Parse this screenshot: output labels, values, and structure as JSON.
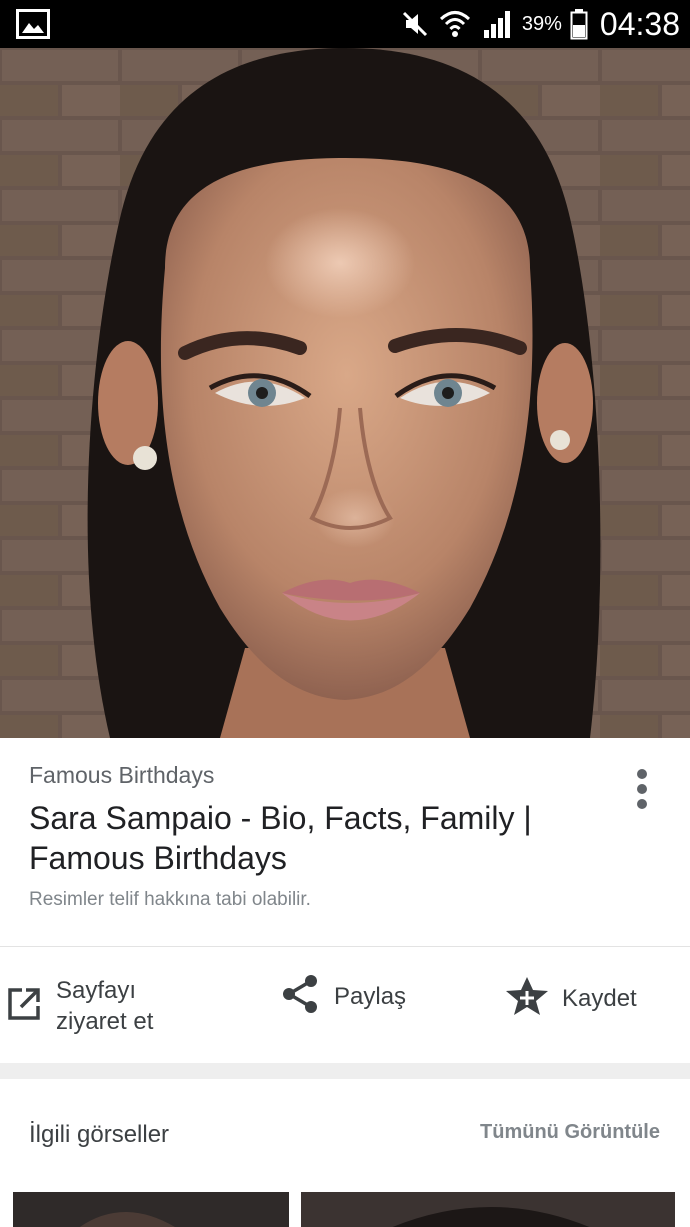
{
  "status_bar": {
    "battery_percent": "39%",
    "time": "04:38",
    "icons": [
      "gallery-icon",
      "mute-icon",
      "wifi-icon",
      "signal-icon",
      "battery-icon"
    ]
  },
  "image": {
    "subject": "portrait-photo"
  },
  "result": {
    "source": "Famous Birthdays",
    "title": "Sara Sampaio - Bio, Facts, Family | Famous Birthdays",
    "copyright_notice": "Resimler telif hakkına tabi olabilir."
  },
  "actions": {
    "visit_label": "Sayfayı ziyaret et",
    "share_label": "Paylaş",
    "save_label": "Kaydet"
  },
  "related": {
    "title": "İlgili görseller",
    "view_all": "Tümünü Görüntüle"
  },
  "colors": {
    "status_bar_bg": "#000000",
    "title_text": "#202124",
    "secondary_text": "#5f6368",
    "muted_text": "#80868b",
    "band_gray": "#eeeeee"
  }
}
